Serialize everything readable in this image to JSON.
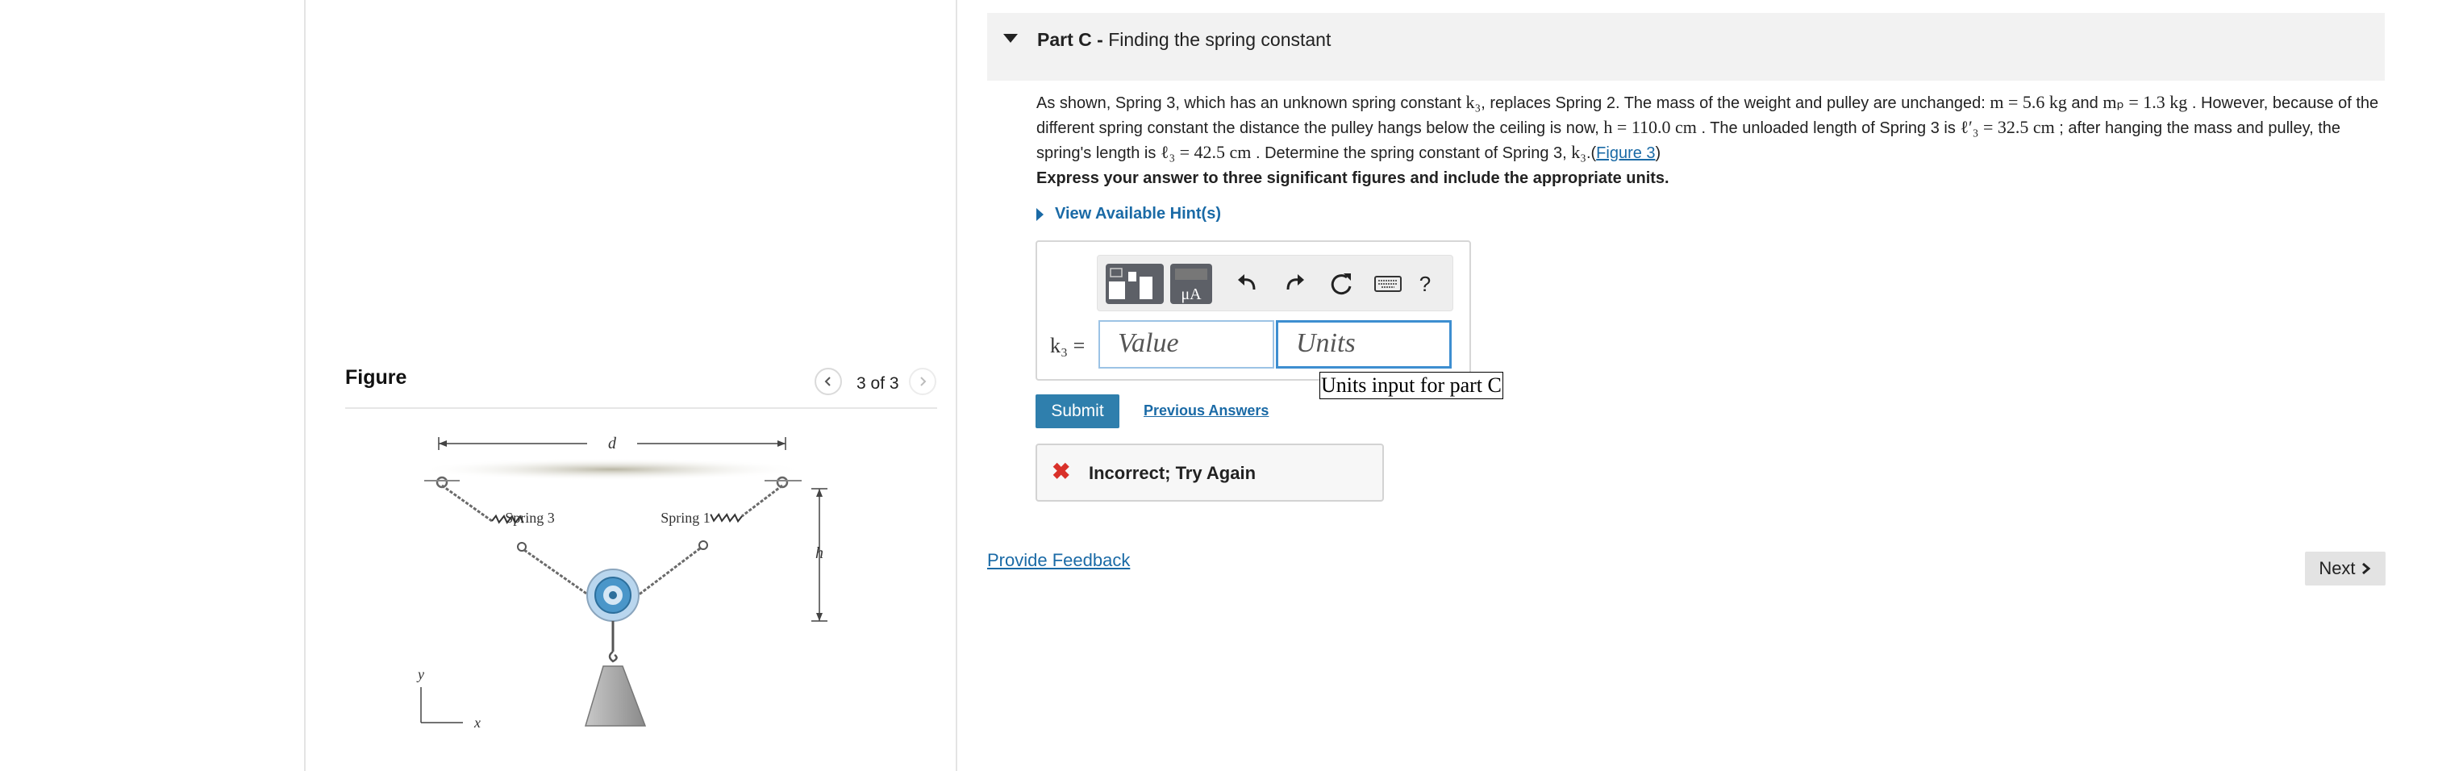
{
  "figure_panel": {
    "title": "Figure",
    "counter": "3 of 3",
    "diagram": {
      "label_d": "d",
      "label_h": "h",
      "label_spring_left": "Spring 3",
      "label_spring_right": "Spring 1",
      "axis_y": "y",
      "axis_x": "x"
    }
  },
  "part": {
    "caret_icon": "triangle-down-icon",
    "prefix": "Part C - ",
    "title": "Finding the spring constant"
  },
  "problem": {
    "t1": "As shown, Spring 3, which has an unknown spring constant ",
    "m_k3": "k₃",
    "t2": ", replaces Spring 2. The mass of the weight and pulley are unchanged: ",
    "m_mass": "m = 5.6 kg",
    "t3": " and ",
    "m_mp": "mₚ = 1.3 kg",
    "t4": " . However, because of the different spring constant the distance the pulley hangs below the ceiling is now, ",
    "m_h": "h = 110.0 cm",
    "t5": " . The unloaded length of Spring 3 is ",
    "m_l3p": "ℓ′₃ = 32.5 cm",
    "t6": " ; after hanging the mass and pulley, the spring's length is ",
    "m_l3": "ℓ₃ = 42.5 cm",
    "t7": " . Determine the spring constant of Spring 3, ",
    "m_k3b": "k₃",
    "t8": ".(",
    "figure_link": "Figure 3",
    "t9": ")"
  },
  "instruction": "Express your answer to three significant figures and include the appropriate units.",
  "hint_link": "View Available Hint(s)",
  "answer": {
    "variable_label": "k₃ =",
    "value_placeholder": "Value",
    "units_placeholder": "Units",
    "units_tooltip": "Units input for part C",
    "toolbar": {
      "templates_icon": "templates-icon",
      "units_icon": "units-icon",
      "units_text": "μA",
      "undo_icon": "undo-icon",
      "redo_icon": "redo-icon",
      "reset_icon": "reset-icon",
      "keyboard_icon": "keyboard-icon",
      "help_label": "?"
    }
  },
  "submit_label": "Submit",
  "previous_answers_label": "Previous Answers",
  "feedback": {
    "icon": "x-icon",
    "symbol": "✖",
    "text": "Incorrect; Try Again"
  },
  "provide_feedback_label": "Provide Feedback",
  "next_label": "Next",
  "colors": {
    "link": "#1a6aa6",
    "submit": "#2f7fad",
    "error": "#d9312a",
    "pulley": "#4a96c9"
  }
}
